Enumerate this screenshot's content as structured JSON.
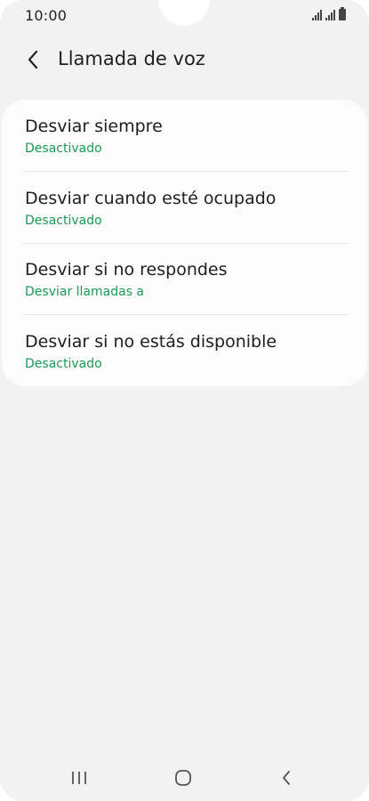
{
  "status_bar": {
    "time": "10:00"
  },
  "header": {
    "title": "Llamada de voz",
    "back_icon": "chevron-left-icon"
  },
  "list": [
    {
      "title": "Desviar siempre",
      "subtitle": "Desactivado"
    },
    {
      "title": "Desviar cuando esté ocupado",
      "subtitle": "Desactivado"
    },
    {
      "title": "Desviar si no respondes",
      "subtitle": "Desviar llamadas a"
    },
    {
      "title": "Desviar si no estás disponible",
      "subtitle": "Desactivado"
    }
  ],
  "nav_bar": {
    "recents_icon": "recents-icon",
    "home_icon": "home-icon",
    "back_icon": "back-icon"
  },
  "colors": {
    "background": "#f2f2f2",
    "card": "#fcfcfc",
    "accent_green": "#1a9a56",
    "text": "#202020"
  }
}
